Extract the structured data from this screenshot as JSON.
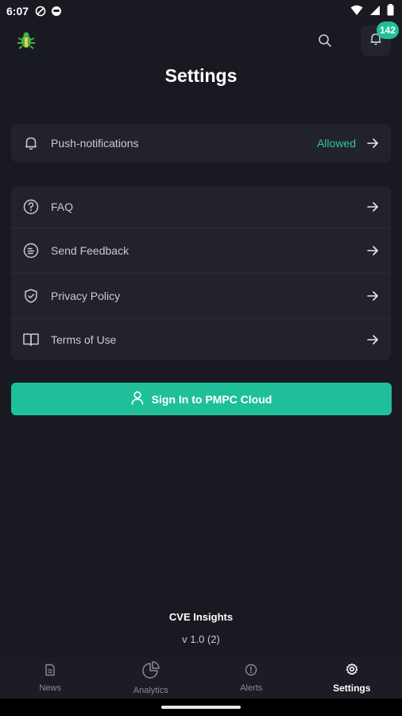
{
  "status_bar": {
    "time": "6:07"
  },
  "header": {
    "title": "Settings",
    "notification_count": "142",
    "logo_icon": "bug-icon",
    "search_icon": "search-icon",
    "bell_icon": "bell-icon"
  },
  "notifications_card": {
    "label": "Push-notifications",
    "status": "Allowed"
  },
  "menu": {
    "items": [
      {
        "label": "FAQ",
        "icon": "question-circle-icon"
      },
      {
        "label": "Send Feedback",
        "icon": "feedback-icon"
      },
      {
        "label": "Privacy Policy",
        "icon": "shield-icon"
      },
      {
        "label": "Terms of Use",
        "icon": "book-icon"
      }
    ]
  },
  "signin": {
    "label": "Sign In to PMPC Cloud"
  },
  "footer": {
    "app_name": "CVE Insights",
    "version": "v 1.0 (2)"
  },
  "bottom_nav": {
    "items": [
      {
        "label": "News",
        "icon": "news-icon"
      },
      {
        "label": "Analytics",
        "icon": "pie-chart-icon"
      },
      {
        "label": "Alerts",
        "icon": "alert-icon"
      },
      {
        "label": "Settings",
        "icon": "gear-icon",
        "active": true
      }
    ]
  },
  "colors": {
    "background": "#191922",
    "card": "#22222d",
    "accent": "#1fbf9a",
    "status_allowed": "#2fc6a0"
  }
}
